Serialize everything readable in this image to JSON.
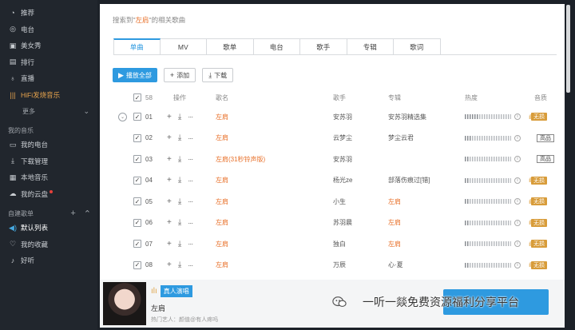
{
  "sidebar": {
    "items": [
      {
        "label": "推荐",
        "icon": "recommend-icon",
        "glyph": "◔"
      },
      {
        "label": "电台",
        "icon": "radio-icon",
        "glyph": "◎"
      },
      {
        "label": "美女秀",
        "icon": "video-icon",
        "glyph": "▣"
      },
      {
        "label": "排行",
        "icon": "chart-icon",
        "glyph": "▤"
      },
      {
        "label": "直播",
        "icon": "mic-icon",
        "glyph": "♁"
      },
      {
        "label": "HiFi发烧音乐",
        "icon": "hifi-icon",
        "glyph": "|||"
      }
    ],
    "more_label": "更多",
    "my_music_title": "我的音乐",
    "my_music": [
      {
        "label": "我的电台",
        "icon": "my-radio-icon",
        "glyph": "▭"
      },
      {
        "label": "下载管理",
        "icon": "download-icon",
        "glyph": "⤓"
      },
      {
        "label": "本地音乐",
        "icon": "local-music-icon",
        "glyph": "▦"
      },
      {
        "label": "我的云盘",
        "icon": "cloud-icon",
        "glyph": "☁"
      }
    ],
    "playlists_title": "自建歌单",
    "playlists": [
      {
        "label": "默认列表",
        "icon": "speaker-icon",
        "glyph": "◀)"
      },
      {
        "label": "我的收藏",
        "icon": "heart-icon",
        "glyph": "♡"
      },
      {
        "label": "好听",
        "icon": "playlist-icon",
        "glyph": "♪"
      }
    ]
  },
  "search": {
    "prefix": "搜索到\"",
    "keyword": "左肩",
    "suffix": "\"的相关歌曲"
  },
  "tabs": [
    "单曲",
    "MV",
    "歌单",
    "电台",
    "歌手",
    "专辑",
    "歌词"
  ],
  "buttons": {
    "play_all": "播放全部",
    "add": "添加",
    "download": "下载"
  },
  "table": {
    "total": "58",
    "headers": {
      "op": "操作",
      "name": "歌名",
      "artist": "歌手",
      "album": "专辑",
      "heat": "热度",
      "quality": "音质"
    },
    "rows": [
      {
        "idx": "01",
        "name": "左肩",
        "artist": "安苏羽",
        "album": "安苏羽精选集",
        "heat": 0.3,
        "quality": "无损",
        "hq": "",
        "album_link": false
      },
      {
        "idx": "02",
        "name": "左肩",
        "artist": "云梦尘",
        "album": "梦尘云君",
        "heat": 0.15,
        "quality": "",
        "hq": "高品",
        "album_link": false
      },
      {
        "idx": "03",
        "name": "左肩(31秒铃声版)",
        "artist": "安苏羽",
        "album": "",
        "heat": 0.1,
        "quality": "",
        "hq": "高品",
        "album_link": false
      },
      {
        "idx": "04",
        "name": "左肩",
        "artist": "杨光ze",
        "album": "部落伤痕过[错]",
        "heat": 0.1,
        "quality": "无损",
        "hq": "",
        "album_link": false
      },
      {
        "idx": "05",
        "name": "左肩",
        "artist": "小生",
        "album": "左肩",
        "heat": 0.1,
        "quality": "无损",
        "hq": "",
        "album_link": true
      },
      {
        "idx": "06",
        "name": "左肩",
        "artist": "苏羽晨",
        "album": "左肩",
        "heat": 0.1,
        "quality": "无损",
        "hq": "",
        "album_link": true
      },
      {
        "idx": "07",
        "name": "左肩",
        "artist": "独白",
        "album": "左肩",
        "heat": 0.1,
        "quality": "无损",
        "hq": "",
        "album_link": true
      },
      {
        "idx": "08",
        "name": "左肩",
        "artist": "万辰",
        "album": "心·夏",
        "heat": 0.1,
        "quality": "无损",
        "hq": "",
        "album_link": false
      }
    ]
  },
  "player": {
    "tag": "真人演唱",
    "title": "左肩",
    "subtitle": "热门艺人：颜值@有人疼吗"
  },
  "watermark": "一听一燚免费资源福利分享平台",
  "colors": {
    "accent": "#2e9ae0",
    "keyword": "#e8702a",
    "gold": "#d89c3a"
  }
}
